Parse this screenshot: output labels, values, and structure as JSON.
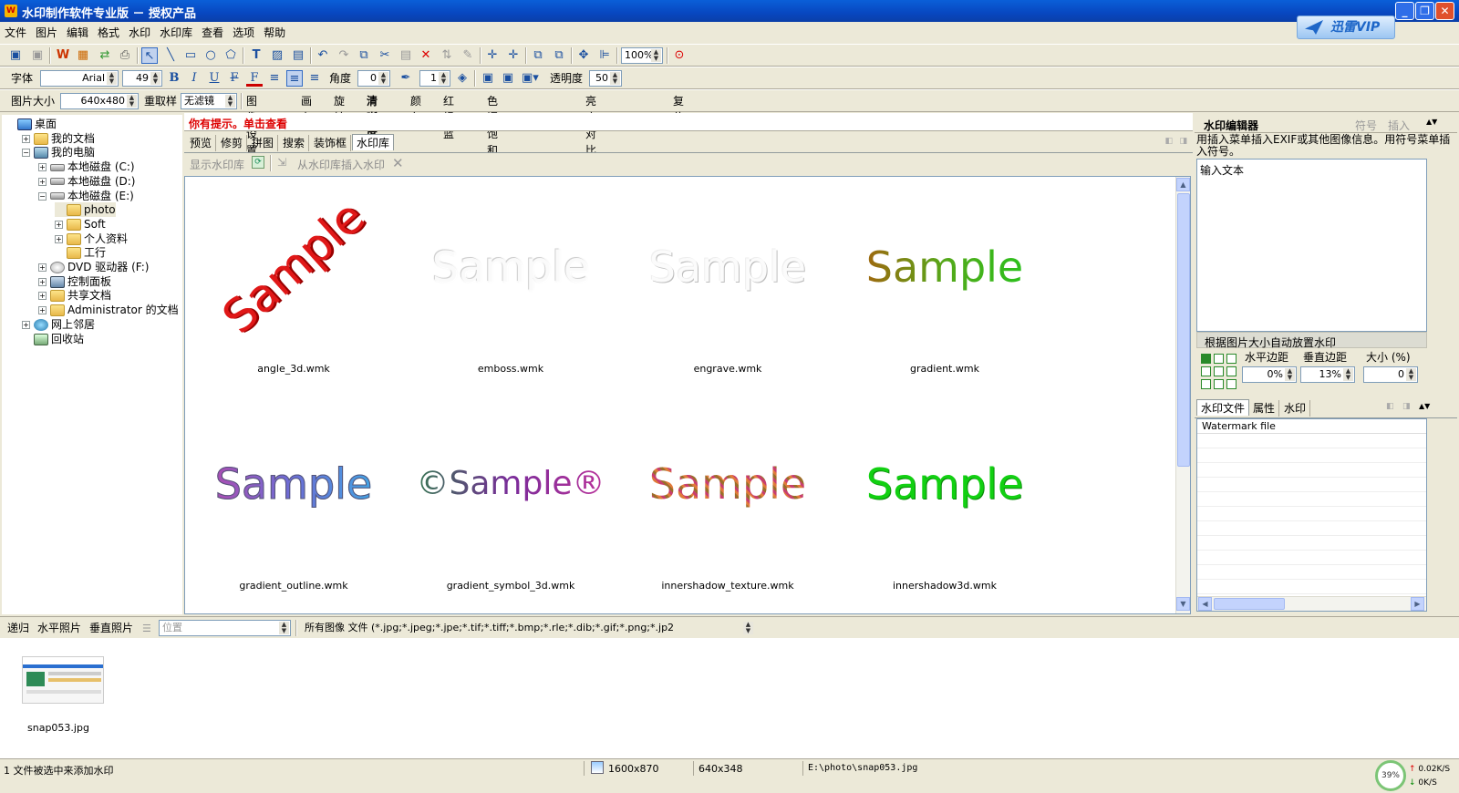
{
  "window": {
    "app_icon": "W",
    "title": "水印制作软件专业版 － 授权产品",
    "minimize": "_",
    "maximize": "❐",
    "close": "✕"
  },
  "vip": {
    "label": "迅雷VIP",
    "icon": "thunder-bird-icon"
  },
  "menu": [
    "文件",
    "图片",
    "编辑",
    "格式",
    "水印",
    "水印库",
    "查看",
    "选项",
    "帮助"
  ],
  "format_bar": {
    "font_label": "字体",
    "font_value": "Arial",
    "size_value": "49",
    "bold": "B",
    "italic": "I",
    "underline": "U",
    "strike": "F",
    "color": "F",
    "angle_label": "角度",
    "angle_value": "0",
    "stroke_value": "1",
    "opacity_label": "透明度",
    "opacity_value": "50"
  },
  "toolbar": {
    "zoom": "100%"
  },
  "image_bar": {
    "size_label": "图片大小",
    "size_value": "640x480",
    "resample": "重取样",
    "filter": "无滤镜",
    "items": [
      "图像设置",
      "画布",
      "旋转",
      "清晰度",
      "颜色",
      "红绿蓝",
      "色调饱和度发光度",
      "亮度对比度伽吗",
      "复位"
    ]
  },
  "tree": [
    {
      "label": "桌面",
      "icon": "desktop",
      "indent": 0,
      "pm": ""
    },
    {
      "label": "我的文档",
      "icon": "folder",
      "indent": 1,
      "pm": "+"
    },
    {
      "label": "我的电脑",
      "icon": "comp",
      "indent": 1,
      "pm": "−"
    },
    {
      "label": "本地磁盘 (C:)",
      "icon": "drive",
      "indent": 2,
      "pm": "+"
    },
    {
      "label": "本地磁盘 (D:)",
      "icon": "drive",
      "indent": 2,
      "pm": "+"
    },
    {
      "label": "本地磁盘 (E:)",
      "icon": "drive",
      "indent": 2,
      "pm": "−"
    },
    {
      "label": "photo",
      "icon": "folder",
      "indent": 3,
      "pm": "",
      "selected": true
    },
    {
      "label": "Soft",
      "icon": "folder",
      "indent": 3,
      "pm": "+"
    },
    {
      "label": "个人资料",
      "icon": "folder",
      "indent": 3,
      "pm": "+"
    },
    {
      "label": "工行",
      "icon": "folder",
      "indent": 3,
      "pm": ""
    },
    {
      "label": "DVD 驱动器 (F:)",
      "icon": "dvd",
      "indent": 2,
      "pm": "+"
    },
    {
      "label": "控制面板",
      "icon": "cp",
      "indent": 2,
      "pm": "+"
    },
    {
      "label": "共享文档",
      "icon": "folder",
      "indent": 2,
      "pm": "+"
    },
    {
      "label": "Administrator 的文档",
      "icon": "folder",
      "indent": 2,
      "pm": "+"
    },
    {
      "label": "网上邻居",
      "icon": "net",
      "indent": 1,
      "pm": "+"
    },
    {
      "label": "回收站",
      "icon": "bin",
      "indent": 1,
      "pm": ""
    }
  ],
  "tip": "你有提示。单击查看",
  "main_tabs": [
    "预览",
    "修剪",
    "拼图",
    "搜索",
    "装饰框",
    "水印库"
  ],
  "lib_toolbar": {
    "show": "显示水印库",
    "insert": "从水印库插入水印"
  },
  "watermarks": [
    {
      "name": "angle_3d.wmk",
      "text": "Sample",
      "style": "angle"
    },
    {
      "name": "emboss.wmk",
      "text": "Sample",
      "style": "emboss"
    },
    {
      "name": "engrave.wmk",
      "text": "Sample",
      "style": "engrave"
    },
    {
      "name": "gradient.wmk",
      "text": "Sample",
      "style": "gradient"
    },
    {
      "name": "gradient_outline.wmk",
      "text": "Sample",
      "style": "gradient_outline"
    },
    {
      "name": "gradient_symbol_3d.wmk",
      "text": "©Sample®",
      "style": "symbol"
    },
    {
      "name": "innershadow_texture.wmk",
      "text": "Sample",
      "style": "texture"
    },
    {
      "name": "innershadow3d.wmk",
      "text": "Sample",
      "style": "green"
    }
  ],
  "editor": {
    "title": "水印编辑器",
    "symbol": "符号",
    "insert": "插入",
    "hint": "用插入菜单插入EXIF或其他图像信息。用符号菜单插入符号。",
    "text": "输入文本"
  },
  "autoscale": {
    "title": "根据图片大小自动放置水印",
    "h_label": "水平边距",
    "v_label": "垂直边距",
    "size_label": "大小 (%)",
    "h_value": "0%",
    "v_value": "13%",
    "size_value": "0"
  },
  "right_tabs": [
    "水印文件",
    "属性",
    "水印"
  ],
  "wm_file_header": "Watermark file",
  "bottom_bar": {
    "recurse": "递归",
    "horizontal": "水平照片",
    "vertical": "垂直照片",
    "location_placeholder": "位置",
    "filter_label": "所有图像 文件 (*.jpg;*.jpeg;*.jpe;*.tif;*.tiff;*.bmp;*.rle;*.dib;*.gif;*.png;*.jp2"
  },
  "files": [
    {
      "name": "snap053.jpg"
    }
  ],
  "status": {
    "message": "1 文件被选中来添加水印",
    "dims": "1600x870",
    "img": "640x348",
    "path": "E:\\photo\\snap053.jpg",
    "cpu": "39%",
    "up": "0.02K/S",
    "down": "0K/S"
  }
}
